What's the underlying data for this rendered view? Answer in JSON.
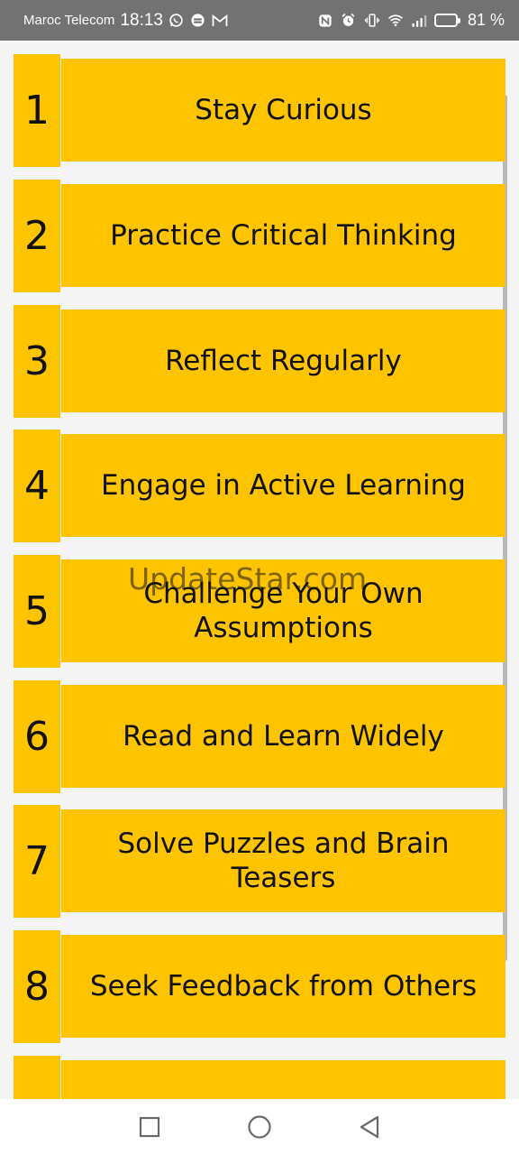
{
  "status_bar": {
    "carrier": "Maroc Telecom",
    "time": "18:13",
    "battery_level": 81,
    "battery_text": "81 %"
  },
  "items": [
    {
      "number": "1",
      "text": "Stay Curious"
    },
    {
      "number": "2",
      "text": "Practice Critical Thinking"
    },
    {
      "number": "3",
      "text": "Reflect Regularly"
    },
    {
      "number": "4",
      "text": "Engage in Active Learning"
    },
    {
      "number": "5",
      "text": "Challenge Your Own Assumptions"
    },
    {
      "number": "6",
      "text": "Read and Learn Widely"
    },
    {
      "number": "7",
      "text": "Solve Puzzles and Brain Teasers"
    },
    {
      "number": "8",
      "text": "Seek Feedback from Others"
    },
    {
      "number": "",
      "text": ""
    }
  ],
  "watermark": "UpdateStar.com",
  "colors": {
    "accent": "#ffc400",
    "status_bar": "#727272",
    "background": "#f4f4f4"
  },
  "nav_icons": [
    "recent-apps-icon",
    "home-icon",
    "back-icon"
  ]
}
